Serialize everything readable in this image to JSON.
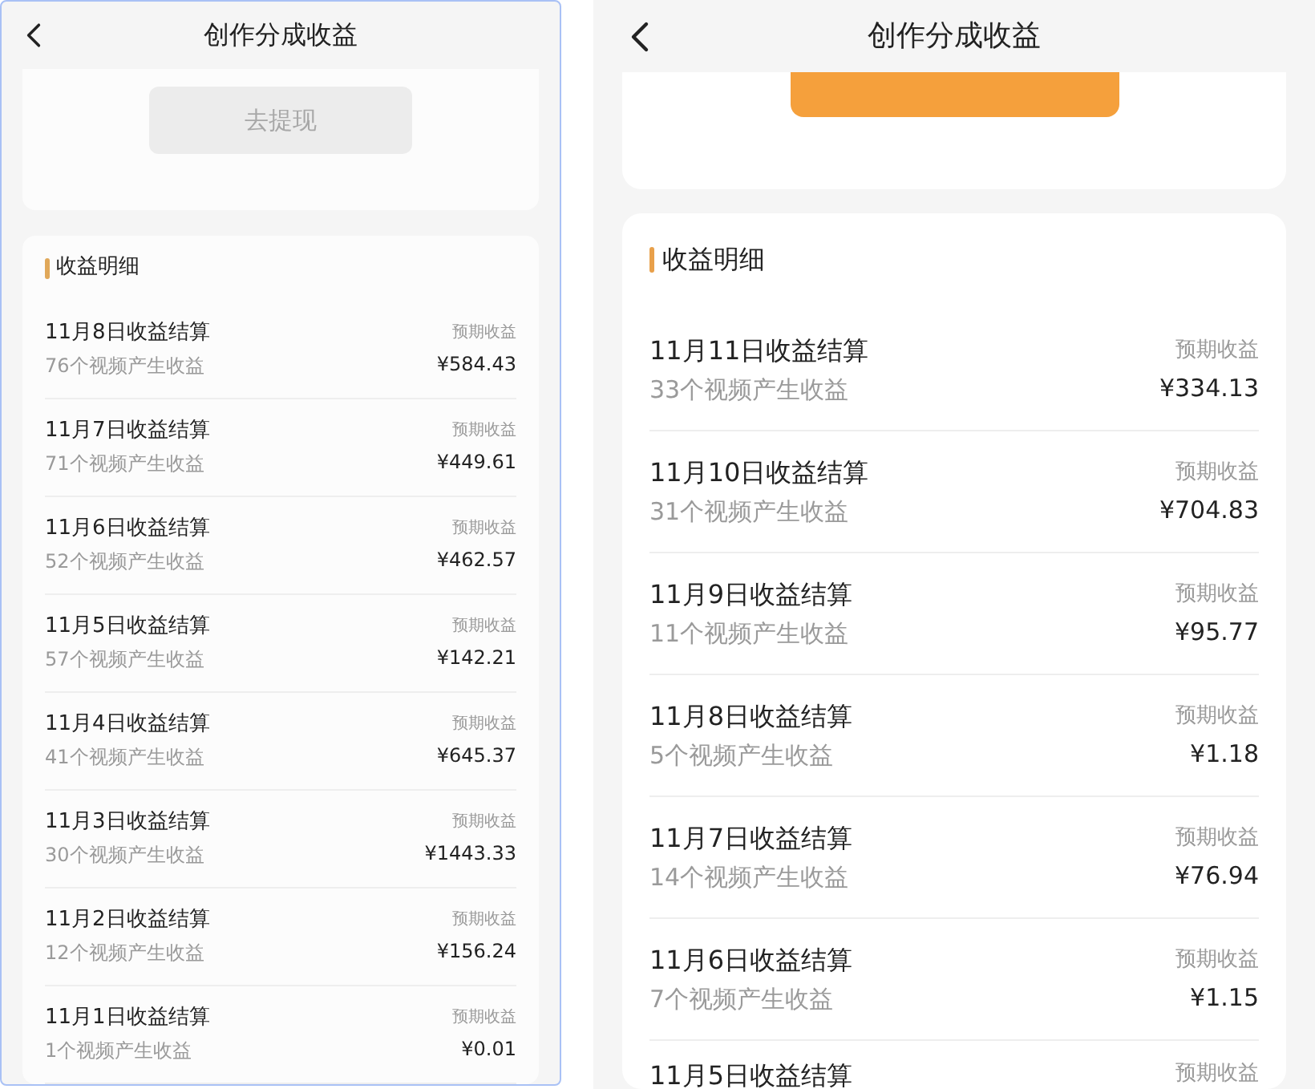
{
  "panels": [
    {
      "title": "创作分成收益",
      "withdraw_button": {
        "label": "去提现",
        "disabled": true
      },
      "section_title": "收益明细",
      "rows": [
        {
          "title": "11月8日收益结算",
          "subtitle": "76个视频产生收益",
          "label": "预期收益",
          "amount": "¥584.43"
        },
        {
          "title": "11月7日收益结算",
          "subtitle": "71个视频产生收益",
          "label": "预期收益",
          "amount": "¥449.61"
        },
        {
          "title": "11月6日收益结算",
          "subtitle": "52个视频产生收益",
          "label": "预期收益",
          "amount": "¥462.57"
        },
        {
          "title": "11月5日收益结算",
          "subtitle": "57个视频产生收益",
          "label": "预期收益",
          "amount": "¥142.21"
        },
        {
          "title": "11月4日收益结算",
          "subtitle": "41个视频产生收益",
          "label": "预期收益",
          "amount": "¥645.37"
        },
        {
          "title": "11月3日收益结算",
          "subtitle": "30个视频产生收益",
          "label": "预期收益",
          "amount": "¥1443.33"
        },
        {
          "title": "11月2日收益结算",
          "subtitle": "12个视频产生收益",
          "label": "预期收益",
          "amount": "¥156.24"
        },
        {
          "title": "11月1日收益结算",
          "subtitle": "1个视频产生收益",
          "label": "预期收益",
          "amount": "¥0.01"
        }
      ]
    },
    {
      "title": "创作分成收益",
      "withdraw_button": {
        "disabled": false
      },
      "section_title": "收益明细",
      "rows": [
        {
          "title": "11月11日收益结算",
          "subtitle": "33个视频产生收益",
          "label": "预期收益",
          "amount": "¥334.13"
        },
        {
          "title": "11月10日收益结算",
          "subtitle": "31个视频产生收益",
          "label": "预期收益",
          "amount": "¥704.83"
        },
        {
          "title": "11月9日收益结算",
          "subtitle": "11个视频产生收益",
          "label": "预期收益",
          "amount": "¥95.77"
        },
        {
          "title": "11月8日收益结算",
          "subtitle": "5个视频产生收益",
          "label": "预期收益",
          "amount": "¥1.18"
        },
        {
          "title": "11月7日收益结算",
          "subtitle": "14个视频产生收益",
          "label": "预期收益",
          "amount": "¥76.94"
        },
        {
          "title": "11月6日收益结算",
          "subtitle": "7个视频产生收益",
          "label": "预期收益",
          "amount": "¥1.15"
        },
        {
          "title": "11月5日收益结算",
          "label": "预期收益"
        }
      ]
    }
  ]
}
